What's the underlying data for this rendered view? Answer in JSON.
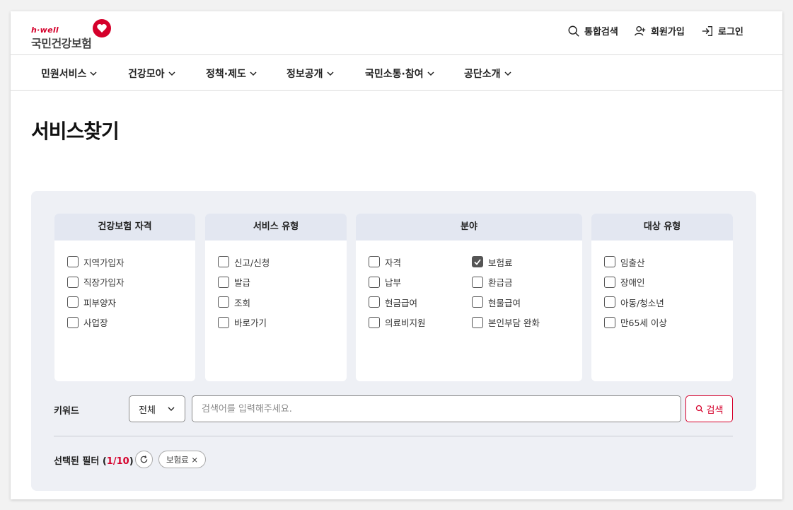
{
  "header": {
    "logo_sub": "h·well",
    "logo_main": "국민건강보험",
    "utils": {
      "search": "통합검색",
      "signup": "회원가입",
      "login": "로그인"
    }
  },
  "nav": {
    "items": [
      {
        "label": "민원서비스"
      },
      {
        "label": "건강모아"
      },
      {
        "label": "정책·제도"
      },
      {
        "label": "정보공개"
      },
      {
        "label": "국민소통·참여"
      },
      {
        "label": "공단소개"
      }
    ]
  },
  "page": {
    "title": "서비스찾기"
  },
  "filters": {
    "qualification": {
      "title": "건강보험 자격",
      "options": [
        {
          "label": "지역가입자",
          "checked": false
        },
        {
          "label": "직장가입자",
          "checked": false
        },
        {
          "label": "피부양자",
          "checked": false
        },
        {
          "label": "사업장",
          "checked": false
        }
      ]
    },
    "service_type": {
      "title": "서비스 유형",
      "options": [
        {
          "label": "신고/신청",
          "checked": false
        },
        {
          "label": "발급",
          "checked": false
        },
        {
          "label": "조회",
          "checked": false
        },
        {
          "label": "바로가기",
          "checked": false
        }
      ]
    },
    "field": {
      "title": "분야",
      "options": [
        {
          "label": "자격",
          "checked": false
        },
        {
          "label": "납부",
          "checked": false
        },
        {
          "label": "현금급여",
          "checked": false
        },
        {
          "label": "의료비지원",
          "checked": false
        },
        {
          "label": "보험료",
          "checked": true
        },
        {
          "label": "환급금",
          "checked": false
        },
        {
          "label": "현물급여",
          "checked": false
        },
        {
          "label": "본인부담 완화",
          "checked": false
        }
      ]
    },
    "target": {
      "title": "대상 유형",
      "options": [
        {
          "label": "임출산",
          "checked": false
        },
        {
          "label": "장애인",
          "checked": false
        },
        {
          "label": "아동/청소년",
          "checked": false
        },
        {
          "label": "만65세 이상",
          "checked": false
        }
      ]
    }
  },
  "keyword": {
    "label": "키워드",
    "scope": "전체",
    "placeholder": "검색어를 입력해주세요.",
    "value": "",
    "button": "검색"
  },
  "selected": {
    "label_prefix": "선택된 필터 (",
    "count": "1/10",
    "label_suffix": ")",
    "chips": [
      {
        "label": "보험료 ×"
      }
    ]
  },
  "colors": {
    "brand_red": "#d5002b",
    "panel_bg": "#eef0f5",
    "box_head_bg": "#e3e7f1"
  }
}
